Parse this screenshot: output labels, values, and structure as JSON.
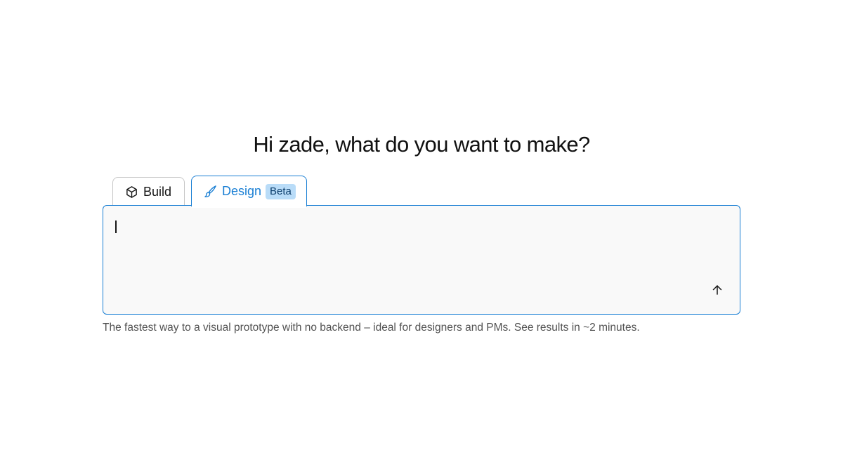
{
  "heading": "Hi zade, what do you want to make?",
  "tabs": [
    {
      "label": "Build",
      "icon": "cube-icon",
      "active": false
    },
    {
      "label": "Design",
      "icon": "paintbrush-icon",
      "active": true,
      "badge": "Beta"
    }
  ],
  "prompt": {
    "value": "",
    "send_icon": "arrow-up-icon"
  },
  "helper_text": "The fastest way to a visual prototype with no backend – ideal for designers and PMs. See results in ~2 minutes.",
  "colors": {
    "accent": "#1a7fd4",
    "badge_bg": "#b9dcf8",
    "box_bg": "#f9f9f9",
    "helper_text": "#525252"
  }
}
